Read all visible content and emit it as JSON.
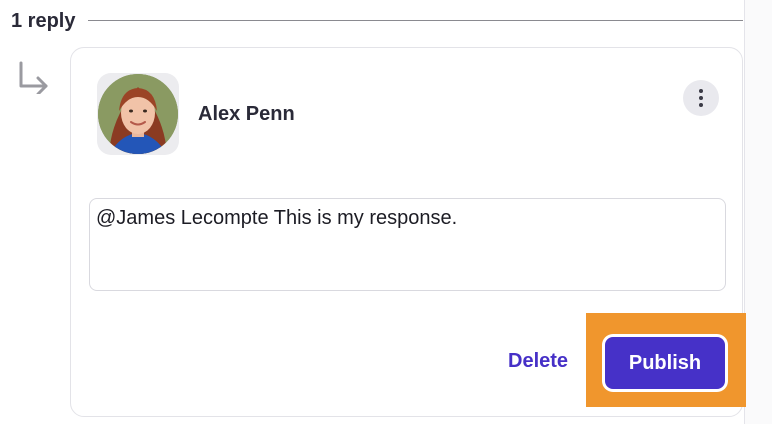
{
  "replies": {
    "count_label": "1 reply"
  },
  "reply": {
    "author": "Alex Penn",
    "text": "@James Lecompte This is my response.",
    "more_icon": "more-vertical-icon",
    "reply_icon": "reply-arrow-icon"
  },
  "actions": {
    "delete_label": "Delete",
    "publish_label": "Publish"
  },
  "colors": {
    "accent": "#4631c8",
    "highlight": "#f0962d"
  }
}
